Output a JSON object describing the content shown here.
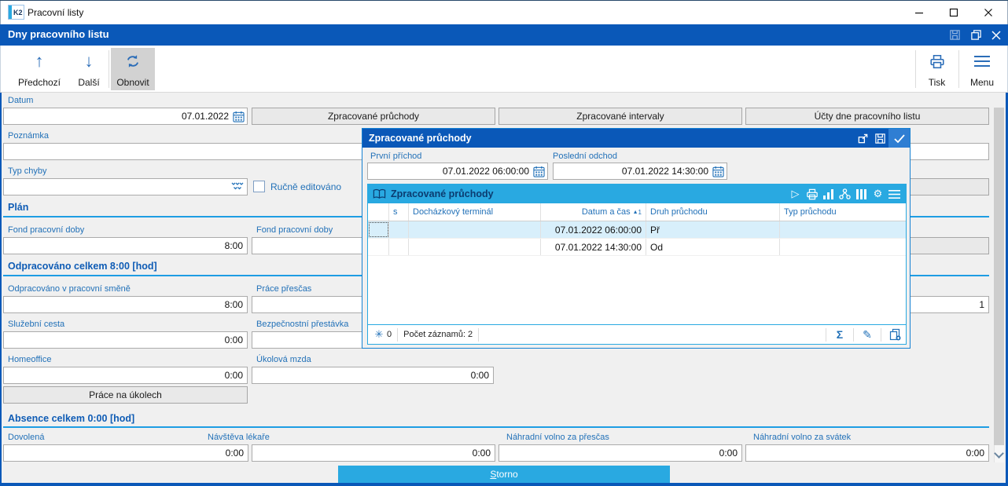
{
  "colors": {
    "accent_dark": "#0a58b8",
    "accent_light": "#29a9e1",
    "label_blue": "#2271b8",
    "selected_row": "#d8effb"
  },
  "titlebar": {
    "app_title": "Pracovní listy",
    "logo": "K2"
  },
  "caption": {
    "title": "Dny pracovního listu"
  },
  "toolbar": {
    "prev": "Předchozí",
    "next": "Další",
    "refresh": "Obnovit",
    "print": "Tisk",
    "menu": "Menu"
  },
  "form": {
    "datum_label": "Datum",
    "datum_value": "07.01.2022",
    "btn_pruchody": "Zpracované průchody",
    "btn_intervaly": "Zpracované intervaly",
    "btn_ucty": "Účty dne pracovního listu",
    "poznamka_label": "Poznámka",
    "poznamka_value": "",
    "typ_chyby_label": "Typ chyby",
    "typ_chyby_value": "",
    "rucne_editovano_label": "Ručně editováno",
    "section_plan": "Plán",
    "fond_left_label": "Fond pracovní doby",
    "fond_left_value": "8:00",
    "fond_right_label": "Fond pracovní doby",
    "fond_right_value": "",
    "section_odpracovano": "Odpracováno celkem 8:00 [hod]",
    "odpracovano_label": "Odpracováno v pracovní směně",
    "odpracovano_value": "8:00",
    "prescas_label": "Práce přesčas",
    "prescas_value": "",
    "right_field_value": "1",
    "sluzebni_label": "Služební cesta",
    "sluzebni_value": "0:00",
    "bezpecnostni_label": "Bezpečnostní přestávka",
    "bezpecnostni_value": "",
    "homeoffice_label": "Homeoffice",
    "homeoffice_value": "0:00",
    "ukolova_label": "Úkolová mzda",
    "ukolova_value": "0:00",
    "btn_ukoly": "Práce na úkolech",
    "section_absence": "Absence celkem 0:00 [hod]",
    "dovolena_label": "Dovolená",
    "dovolena_value": "0:00",
    "navsteva_label": "Návštěva lékaře",
    "navsteva_value": "0:00",
    "nv_prescas_label": "Náhradní volno za přesčas",
    "nv_prescas_value": "0:00",
    "nv_svatek_label": "Náhradní volno za svátek",
    "nv_svatek_value": "0:00",
    "storno_accel": "S",
    "storno_rest": "torno"
  },
  "dialog": {
    "title": "Zpracované průchody",
    "prichod_label": "První příchod",
    "prichod_value": "07.01.2022 06:00:00",
    "odchod_label": "Poslední odchod",
    "odchod_value": "07.01.2022 14:30:00",
    "grid": {
      "caption": "Zpracované průchody",
      "columns": [
        "",
        "s",
        "Docházkový terminál",
        "Datum a čas",
        "Druh průchodu",
        "Typ průchodu"
      ],
      "sort_indicator": "▲",
      "sort_order": "1",
      "rows": [
        {
          "s": "",
          "terminal": "",
          "datetime": "07.01.2022 06:00:00",
          "druh": "Př",
          "typ": ""
        },
        {
          "s": "",
          "terminal": "",
          "datetime": "07.01.2022 14:30:00",
          "druh": "Od",
          "typ": ""
        }
      ],
      "pending_count": "0",
      "record_count": "Počet záznamů: 2",
      "sum_symbol": "Σ"
    }
  }
}
